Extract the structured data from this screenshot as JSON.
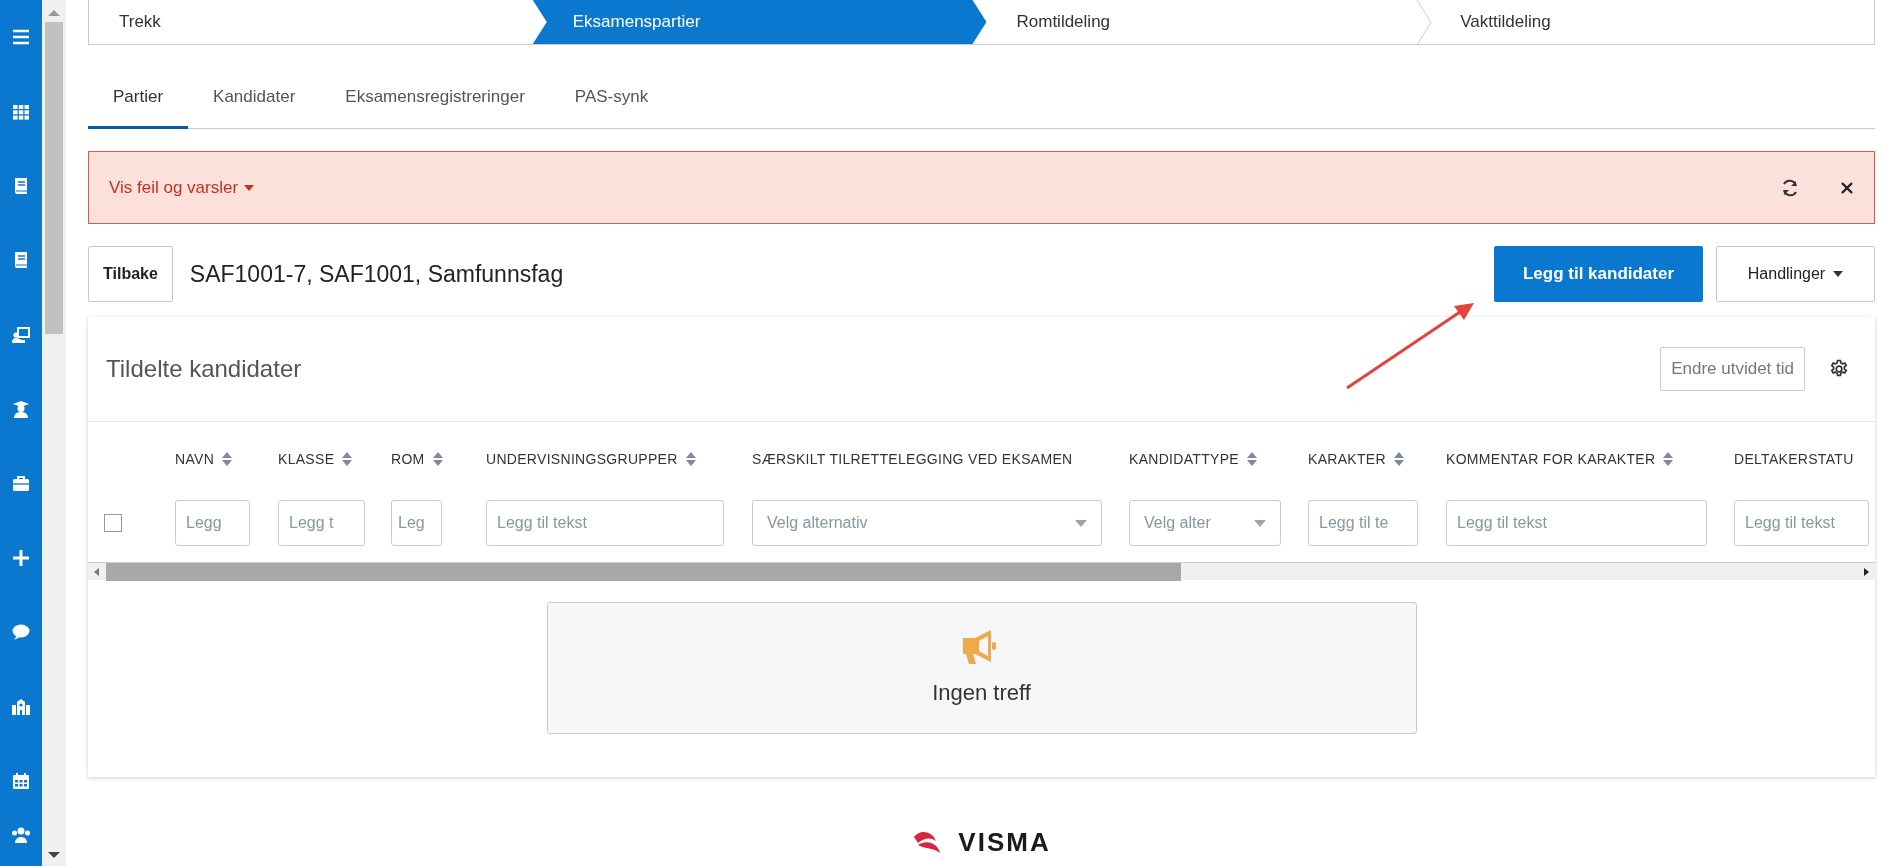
{
  "steps": [
    {
      "label": "Trekk",
      "selected": false
    },
    {
      "label": "Eksamenspartier",
      "selected": true
    },
    {
      "label": "Romtildeling",
      "selected": false
    },
    {
      "label": "Vakttildeling",
      "selected": false
    }
  ],
  "tabs": [
    {
      "label": "Partier",
      "selected": true
    },
    {
      "label": "Kandidater",
      "selected": false
    },
    {
      "label": "Eksamensregistreringer",
      "selected": false
    },
    {
      "label": "PAS-synk",
      "selected": false
    }
  ],
  "alert": {
    "label": "Vis feil og varsler"
  },
  "header": {
    "back_button": "Tilbake",
    "title": "SAF1001-7, SAF1001, Samfunnsfag",
    "primary_button": "Legg til kandidater",
    "actions_button": "Handlinger"
  },
  "card": {
    "title": "Tildelte kandidater",
    "extended_time_button": "Endre utvidet tid"
  },
  "table": {
    "select_all": {
      "checked": false
    },
    "columns": [
      {
        "label": "NAVN",
        "sortable": true,
        "filter": {
          "kind": "text",
          "placeholder": "Legg"
        }
      },
      {
        "label": "KLASSE",
        "sortable": true,
        "filter": {
          "kind": "text",
          "placeholder": "Legg t"
        }
      },
      {
        "label": "ROM",
        "sortable": true,
        "filter": {
          "kind": "text",
          "placeholder": "Leg"
        }
      },
      {
        "label": "UNDERVISNINGSGRUPPER",
        "sortable": true,
        "filter": {
          "kind": "text",
          "placeholder": "Legg til tekst"
        }
      },
      {
        "label": "SÆRSKILT TILRETTELEGGING VED EKSAMEN",
        "sortable": false,
        "filter": {
          "kind": "select",
          "placeholder": "Velg alternativ"
        }
      },
      {
        "label": "KANDIDATTYPE",
        "sortable": true,
        "filter": {
          "kind": "select",
          "placeholder": "Velg alter"
        }
      },
      {
        "label": "KARAKTER",
        "sortable": true,
        "filter": {
          "kind": "text",
          "placeholder": "Legg til te"
        }
      },
      {
        "label": "KOMMENTAR FOR KARAKTER",
        "sortable": true,
        "filter": {
          "kind": "text",
          "placeholder": "Legg til tekst"
        }
      },
      {
        "label": "DELTAKERSTATU",
        "sortable": false,
        "filter": {
          "kind": "text",
          "placeholder": "Legg til tekst"
        }
      }
    ]
  },
  "empty_state": {
    "message": "Ingen treff"
  },
  "footer": {
    "logo": "VISMA"
  }
}
